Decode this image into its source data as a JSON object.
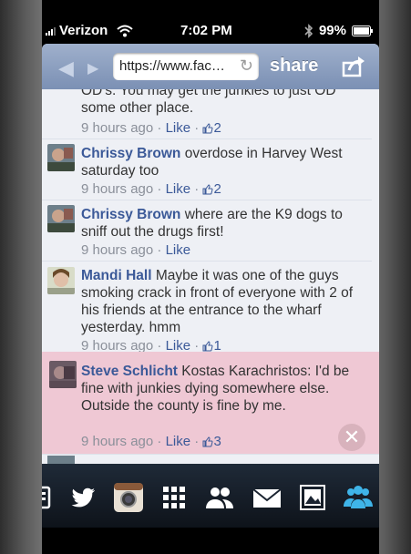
{
  "status_bar": {
    "carrier": "Verizon",
    "time": "7:02 PM",
    "battery": "99%"
  },
  "browser": {
    "url": "https://www.fac…",
    "share_label": "share"
  },
  "comments": [
    {
      "id": "c0",
      "name": "",
      "text": "OD's. You may get the junkies to just OD some other place.",
      "time": "9 hours ago",
      "like": "Like",
      "likes": "2"
    },
    {
      "id": "c1",
      "name": "Chrissy Brown",
      "text": " overdose in Harvey West saturday too",
      "time": "9 hours ago",
      "like": "Like",
      "likes": "2"
    },
    {
      "id": "c2",
      "name": "Chrissy Brown",
      "text": " where are the K9 dogs to sniff out the drugs first!",
      "time": "9 hours ago",
      "like": "Like",
      "likes": ""
    },
    {
      "id": "c3",
      "name": "Mandi Hall",
      "text": " Maybe it was one of the guys smoking crack in front of everyone with 2 of his friends at the entrance to the wharf yesterday. hmm",
      "time": "9 hours ago",
      "like": "Like",
      "likes": "1"
    },
    {
      "id": "c4",
      "name": "Steve Schlicht",
      "mention": "Kostas Karachristos",
      "text": ": I'd be fine with junkies dying somewhere else. Outside the county is fine by me.",
      "time": "9 hours ago",
      "like": "Like",
      "likes": "3"
    }
  ],
  "meta_separator": " · ",
  "colors": {
    "link": "#3b5998",
    "highlight": "#efc8d4",
    "toolbar": "#8a9dc0"
  },
  "dock_icons": [
    "contacts-card-icon",
    "twitter-icon",
    "instagram-icon",
    "grid-icon",
    "people-icon",
    "mail-icon",
    "photos-icon",
    "groups-icon"
  ]
}
